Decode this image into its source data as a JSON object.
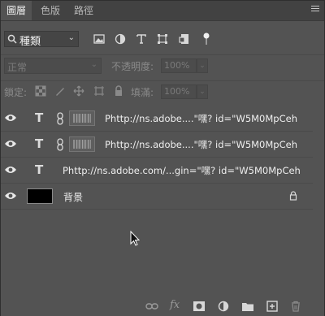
{
  "tabs": [
    {
      "label": "圖層",
      "active": true
    },
    {
      "label": "色版",
      "active": false
    },
    {
      "label": "路徑",
      "active": false
    }
  ],
  "filter": {
    "kind_label": "種類",
    "icons": [
      "image-filter-icon",
      "adjustment-filter-icon",
      "type-filter-icon",
      "shape-filter-icon",
      "smart-object-filter-icon",
      "filter-toggle-icon"
    ]
  },
  "blend": {
    "mode": "正常",
    "opacity_label": "不透明度:",
    "opacity_value": "100%"
  },
  "lock": {
    "label": "鎖定:",
    "fill_label": "填滿:",
    "fill_value": "100%"
  },
  "layers": [
    {
      "type": "text",
      "name": "Phttp://ns.adobe....\"嘿? id=\"W5M0MpCeh",
      "linked": true,
      "has_thumb": true
    },
    {
      "type": "text",
      "name": "Phttp://ns.adobe....\"嘿? id=\"W5M0MpCeh",
      "linked": true,
      "has_thumb": true
    },
    {
      "type": "text",
      "name": "Phttp://ns.adobe.com/...gin=\"嘿? id=\"W5M0MpCeh",
      "linked": false,
      "has_thumb": false
    },
    {
      "type": "background",
      "name": "背景",
      "locked": true
    }
  ],
  "footer": {
    "fx_label": "fx",
    "icons": [
      "link-layers-icon",
      "fx-icon",
      "add-mask-icon",
      "new-adjustment-icon",
      "new-group-icon",
      "new-layer-icon",
      "delete-layer-icon"
    ]
  },
  "colors": {
    "panel_bg": "#535353",
    "tab_bar": "#424242",
    "text": "#eeeeee"
  }
}
